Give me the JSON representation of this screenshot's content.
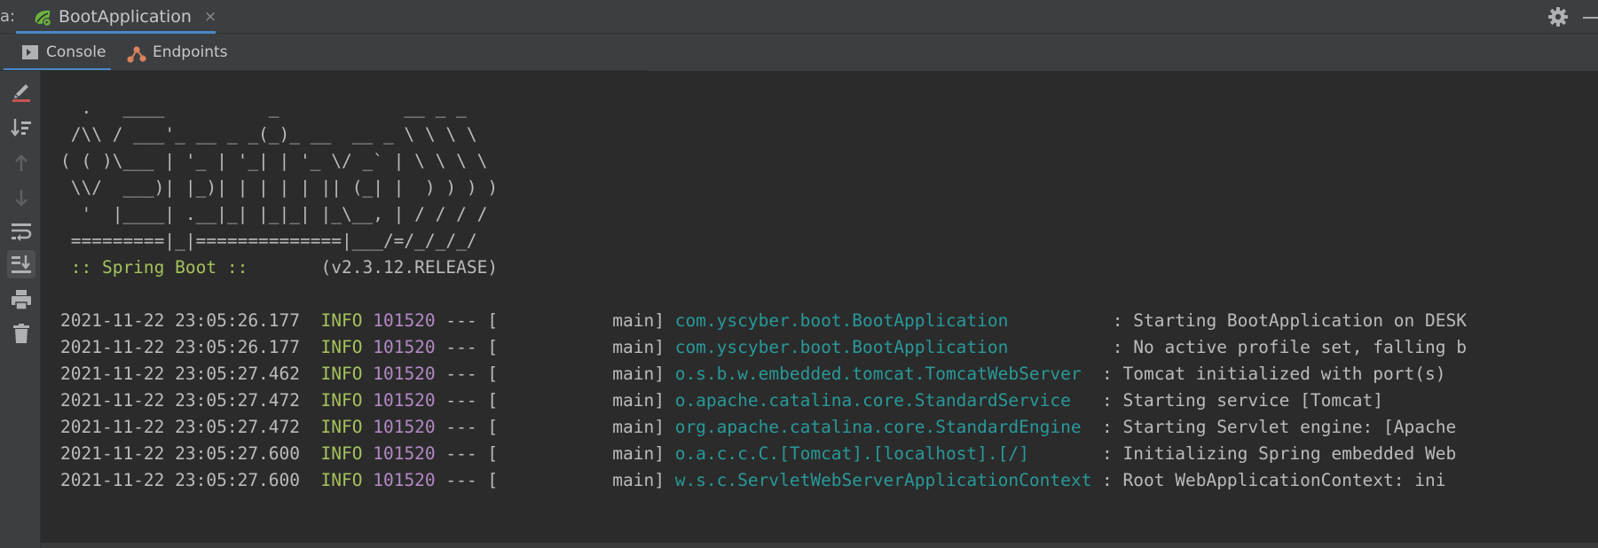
{
  "top_bar": {
    "prefix": "a:",
    "run_tab_label": "BootApplication",
    "close_glyph": "×",
    "icons": [
      "spring-boot-icon",
      "gear-icon",
      "minimize-icon"
    ]
  },
  "sub_tabs": [
    {
      "label": "Console",
      "icon": "console-icon",
      "active": true
    },
    {
      "label": "Endpoints",
      "icon": "endpoints-icon",
      "active": false
    }
  ],
  "toolbar_icons": [
    "clear-all-icon",
    "sort-icon",
    "up-arrow-icon",
    "down-arrow-icon",
    "soft-wrap-icon",
    "scroll-to-end-icon",
    "print-icon",
    "trash-icon"
  ],
  "console": {
    "banner": [
      "  .   ____          _            __ _ _",
      " /\\\\ / ___'_ __ _ _(_)_ __  __ _ \\ \\ \\ \\",
      "( ( )\\___ | '_ | '_| | '_ \\/ _` | \\ \\ \\ \\",
      " \\\\/  ___)| |_)| | | | | || (_| |  ) ) ) )",
      "  '  |____| .__|_| |_|_| |_\\__, | / / / /",
      " =========|_|==============|___/=/_/_/_/"
    ],
    "spring_boot_label": " :: Spring Boot :: ",
    "version": "      (v2.3.12.RELEASE)",
    "log_lines": [
      {
        "timestamp": "2021-11-22 23:05:26.177  ",
        "level": "INFO",
        "pid": "101520",
        "thread": " --- [           main] ",
        "logger": "com.yscyber.boot.BootApplication        ",
        "message": "  : Starting BootApplication on DESK"
      },
      {
        "timestamp": "2021-11-22 23:05:26.177  ",
        "level": "INFO",
        "pid": "101520",
        "thread": " --- [           main] ",
        "logger": "com.yscyber.boot.BootApplication        ",
        "message": "  : No active profile set, falling b"
      },
      {
        "timestamp": "2021-11-22 23:05:27.462  ",
        "level": "INFO",
        "pid": "101520",
        "thread": " --- [           main] ",
        "logger": "o.s.b.w.embedded.tomcat.TomcatWebServer ",
        "message": " : Tomcat initialized with port(s)"
      },
      {
        "timestamp": "2021-11-22 23:05:27.472  ",
        "level": "INFO",
        "pid": "101520",
        "thread": " --- [           main] ",
        "logger": "o.apache.catalina.core.StandardService  ",
        "message": " : Starting service [Tomcat]"
      },
      {
        "timestamp": "2021-11-22 23:05:27.472  ",
        "level": "INFO",
        "pid": "101520",
        "thread": " --- [           main] ",
        "logger": "org.apache.catalina.core.StandardEngine ",
        "message": " : Starting Servlet engine: [Apache"
      },
      {
        "timestamp": "2021-11-22 23:05:27.600  ",
        "level": "INFO",
        "pid": "101520",
        "thread": " --- [           main] ",
        "logger": "o.a.c.c.C.[Tomcat].[localhost].[/]      ",
        "message": " : Initializing Spring embedded Web"
      },
      {
        "timestamp": "2021-11-22 23:05:27.600  ",
        "level": "INFO",
        "pid": "101520",
        "thread": " --- [           main] ",
        "logger": "w.s.c.ServletWebServerApplicationContext",
        "message": " : Root WebApplicationContext: ini"
      }
    ]
  },
  "colors": {
    "background": "#2b2b2b",
    "panel": "#3c3f41",
    "accent": "#4a88c7",
    "level": "#a5c25c",
    "pid": "#b389c5",
    "logger": "#299999",
    "text": "#bbbbbb"
  }
}
